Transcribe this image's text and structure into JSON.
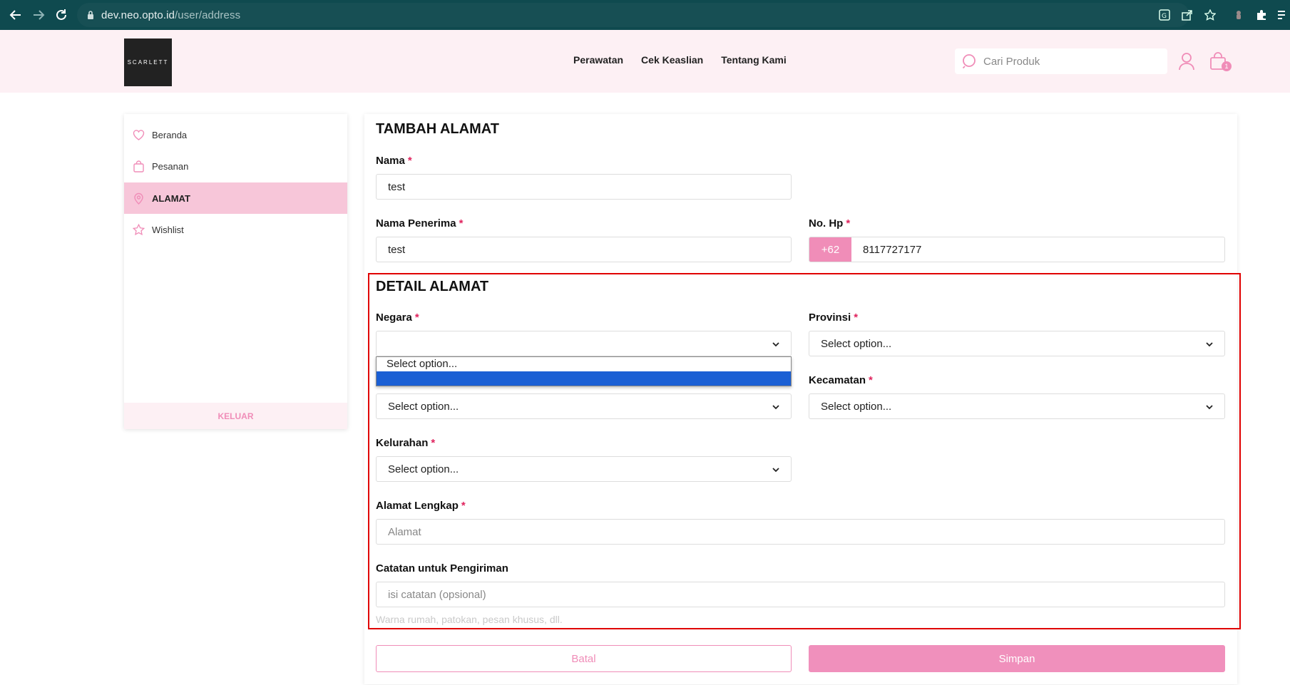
{
  "browser": {
    "url_domain": "dev.neo.opto.id",
    "url_path": "/user/address"
  },
  "header": {
    "logo_text": "SCARLETT",
    "nav": [
      "Perawatan",
      "Cek Keaslian",
      "Tentang Kami"
    ],
    "search_placeholder": "Cari Produk",
    "cart_count": "1"
  },
  "sidebar": {
    "items": [
      {
        "label": "Beranda",
        "icon": "heart-icon"
      },
      {
        "label": "Pesanan",
        "icon": "bag-icon"
      },
      {
        "label": "ALAMAT",
        "icon": "location-pin-icon",
        "active": true
      },
      {
        "label": "Wishlist",
        "icon": "star-icon"
      }
    ],
    "logout_label": "KELUAR"
  },
  "form": {
    "title": "TAMBAH ALAMAT",
    "nama": {
      "label": "Nama",
      "value": "test"
    },
    "nama_penerima": {
      "label": "Nama Penerima",
      "value": "test"
    },
    "no_hp": {
      "label": "No. Hp",
      "prefix": "+62",
      "value": "8117727177"
    },
    "detail_title": "DETAIL ALAMAT",
    "negara": {
      "label": "Negara",
      "value": ""
    },
    "negara_dropdown": {
      "options": [
        "Select option..."
      ]
    },
    "provinsi": {
      "label": "Provinsi",
      "value": "Select option..."
    },
    "kota": {
      "value": "Select option..."
    },
    "kecamatan": {
      "label": "Kecamatan",
      "value": "Select option..."
    },
    "kelurahan": {
      "label": "Kelurahan",
      "value": "Select option..."
    },
    "alamat_lengkap": {
      "label": "Alamat Lengkap",
      "placeholder": "Alamat"
    },
    "catatan": {
      "label": "Catatan untuk Pengiriman",
      "placeholder": "isi catatan (opsional)",
      "hint": "Warna rumah, patokan, pesan khusus, dll."
    },
    "cancel_label": "Batal",
    "save_label": "Simpan"
  },
  "colors": {
    "accent": "#f08db8",
    "browser_bar": "#0f4a4f",
    "header_bg": "#fdf0f4",
    "highlight": "#e00000",
    "dropdown_selected": "#1a5fd4"
  }
}
